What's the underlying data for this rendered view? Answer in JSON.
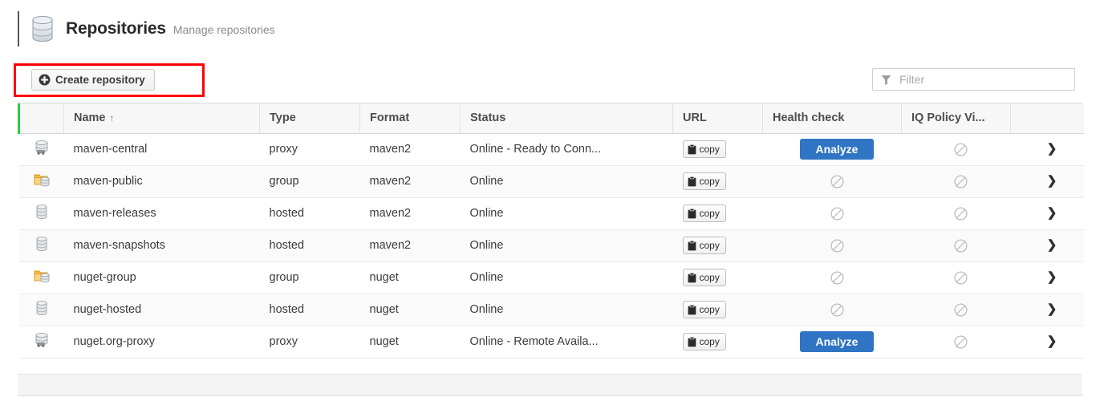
{
  "header": {
    "icon": "database-icon",
    "title": "Repositories",
    "subtitle": "Manage repositories"
  },
  "toolbar": {
    "create_label": "Create repository",
    "create_icon": "plus-circle-icon",
    "highlight_color": "#ff0000",
    "filter": {
      "icon": "funnel-icon",
      "placeholder": "Filter",
      "value": ""
    }
  },
  "table": {
    "accent_color": "#2ecc40",
    "columns": [
      {
        "key": "icon",
        "label": ""
      },
      {
        "key": "name",
        "label": "Name",
        "sort": "↑"
      },
      {
        "key": "type",
        "label": "Type"
      },
      {
        "key": "format",
        "label": "Format"
      },
      {
        "key": "status",
        "label": "Status"
      },
      {
        "key": "url",
        "label": "URL"
      },
      {
        "key": "health",
        "label": "Health check"
      },
      {
        "key": "iq",
        "label": "IQ Policy Vi..."
      },
      {
        "key": "more",
        "label": ""
      }
    ],
    "copy_label": "copy",
    "copy_icon": "clipboard-icon",
    "analyze_label": "Analyze",
    "analyze_color": "#3075c4",
    "disabled_icon": "no-entry-icon",
    "chevron_icon": "chevron-right-icon",
    "rows": [
      {
        "icon": "repository-proxy-icon",
        "name": "maven-central",
        "type": "proxy",
        "format": "maven2",
        "status": "Online - Ready to Conn...",
        "url": "copy",
        "health": "analyze",
        "iq": "disabled"
      },
      {
        "icon": "repository-group-icon",
        "name": "maven-public",
        "type": "group",
        "format": "maven2",
        "status": "Online",
        "url": "copy",
        "health": "disabled",
        "iq": "disabled"
      },
      {
        "icon": "repository-hosted-icon",
        "name": "maven-releases",
        "type": "hosted",
        "format": "maven2",
        "status": "Online",
        "url": "copy",
        "health": "disabled",
        "iq": "disabled"
      },
      {
        "icon": "repository-hosted-icon",
        "name": "maven-snapshots",
        "type": "hosted",
        "format": "maven2",
        "status": "Online",
        "url": "copy",
        "health": "disabled",
        "iq": "disabled"
      },
      {
        "icon": "repository-group-icon",
        "name": "nuget-group",
        "type": "group",
        "format": "nuget",
        "status": "Online",
        "url": "copy",
        "health": "disabled",
        "iq": "disabled"
      },
      {
        "icon": "repository-hosted-icon",
        "name": "nuget-hosted",
        "type": "hosted",
        "format": "nuget",
        "status": "Online",
        "url": "copy",
        "health": "disabled",
        "iq": "disabled"
      },
      {
        "icon": "repository-proxy-icon",
        "name": "nuget.org-proxy",
        "type": "proxy",
        "format": "nuget",
        "status": "Online - Remote Availa...",
        "url": "copy",
        "health": "analyze",
        "iq": "disabled"
      }
    ]
  }
}
